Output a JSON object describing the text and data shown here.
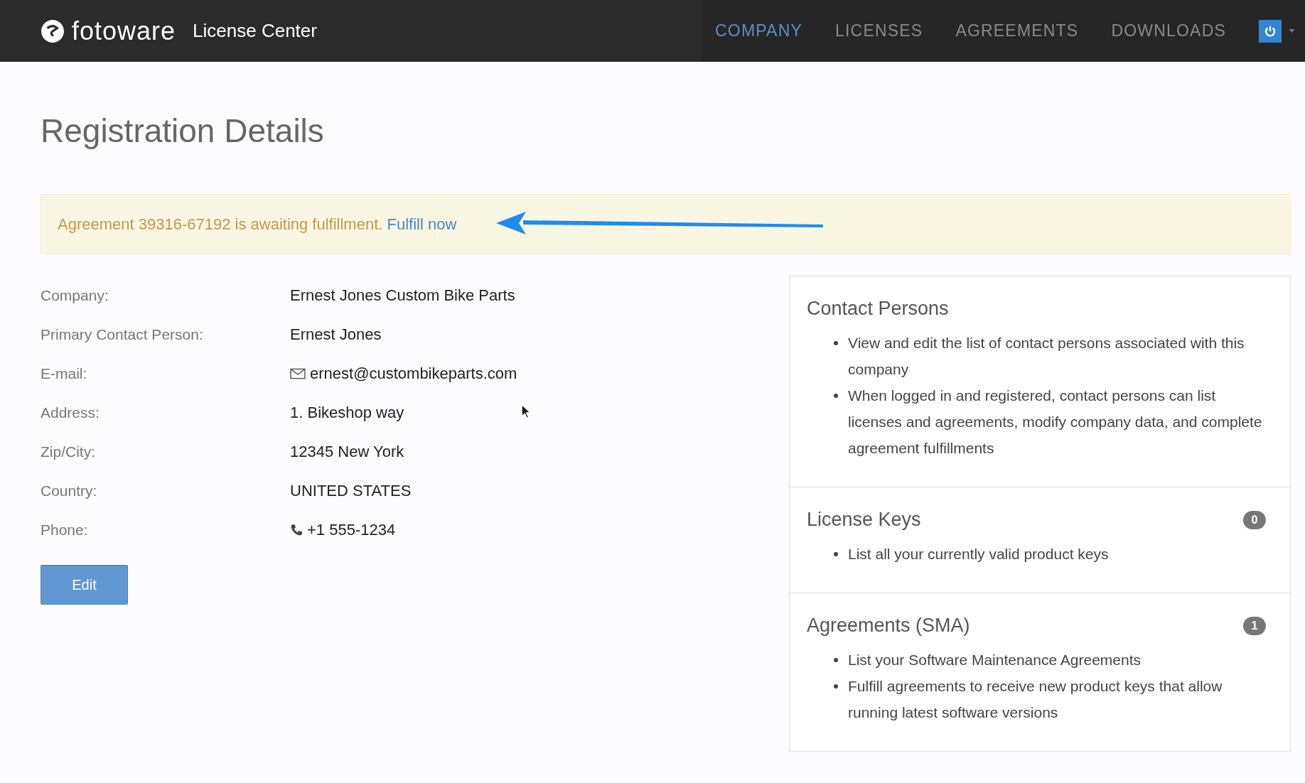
{
  "header": {
    "brand": "fotoware",
    "app_title": "License Center",
    "nav": [
      {
        "label": "COMPANY",
        "selected": true
      },
      {
        "label": "LICENSES",
        "selected": false
      },
      {
        "label": "AGREEMENTS",
        "selected": false
      },
      {
        "label": "DOWNLOADS",
        "selected": false
      }
    ]
  },
  "page_title": "Registration Details",
  "alert": {
    "message": "Agreement 39316-67192 is awaiting fulfillment.",
    "link": "Fulfill now"
  },
  "details": [
    {
      "label": "Company:",
      "value": "Ernest Jones Custom Bike Parts",
      "kind": "text"
    },
    {
      "label": "Primary Contact Person:",
      "value": "Ernest Jones",
      "kind": "text"
    },
    {
      "label": "E-mail:",
      "value": "ernest@custombikeparts.com",
      "kind": "email"
    },
    {
      "label": "Address:",
      "value": "1. Bikeshop way",
      "kind": "text"
    },
    {
      "label": "Zip/City:",
      "value": "12345 New York",
      "kind": "text"
    },
    {
      "label": "Country:",
      "value": "UNITED STATES",
      "kind": "text"
    },
    {
      "label": "Phone:",
      "value": "+1 555-1234",
      "kind": "phone"
    }
  ],
  "edit_button": "Edit",
  "panels": [
    {
      "title": "Contact Persons",
      "items": [
        "View and edit the list of contact persons associated with this company",
        "When logged in and registered, contact persons can list licenses and agreements, modify company data, and complete agreement fulfillments"
      ]
    },
    {
      "title": "License Keys",
      "count": "0",
      "items": [
        "List all your currently valid product keys"
      ]
    },
    {
      "title": "Agreements (SMA)",
      "count": "1",
      "items": [
        "List your Software Maintenance Agreements",
        "Fulfill agreements to receive new product keys that allow running latest software versions"
      ]
    }
  ]
}
